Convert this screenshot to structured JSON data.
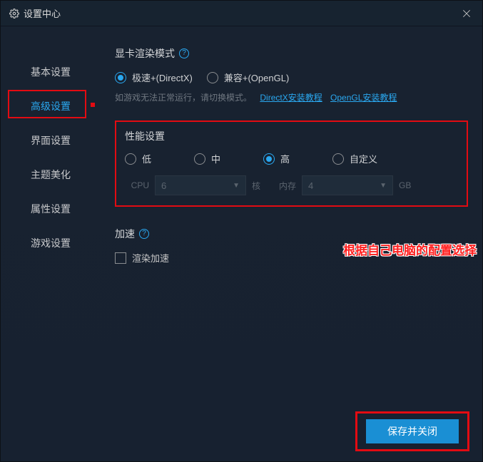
{
  "window": {
    "title": "设置中心"
  },
  "sidebar": {
    "items": [
      {
        "label": "基本设置"
      },
      {
        "label": "高级设置"
      },
      {
        "label": "界面设置"
      },
      {
        "label": "主题美化"
      },
      {
        "label": "属性设置"
      },
      {
        "label": "游戏设置"
      }
    ],
    "active_index": 1
  },
  "render_mode": {
    "title": "显卡渲染模式",
    "options": [
      {
        "label": "极速+(DirectX)",
        "selected": true
      },
      {
        "label": "兼容+(OpenGL)",
        "selected": false
      }
    ],
    "hint_text": "如游戏无法正常运行，请切换模式。",
    "link1": "DirectX安装教程",
    "link2": "OpenGL安装教程"
  },
  "perf": {
    "title": "性能设置",
    "options": [
      {
        "label": "低",
        "selected": false
      },
      {
        "label": "中",
        "selected": false
      },
      {
        "label": "高",
        "selected": true
      },
      {
        "label": "自定义",
        "selected": false
      }
    ],
    "cpu_label": "CPU",
    "cpu_value": "6",
    "cpu_unit": "核",
    "mem_label": "内存",
    "mem_value": "4",
    "mem_unit": "GB"
  },
  "accel": {
    "title": "加速",
    "checkbox_label": "渲染加速",
    "checked": false
  },
  "footer": {
    "save_label": "保存并关闭"
  },
  "annotation": "根据自己电脑的配置选择"
}
